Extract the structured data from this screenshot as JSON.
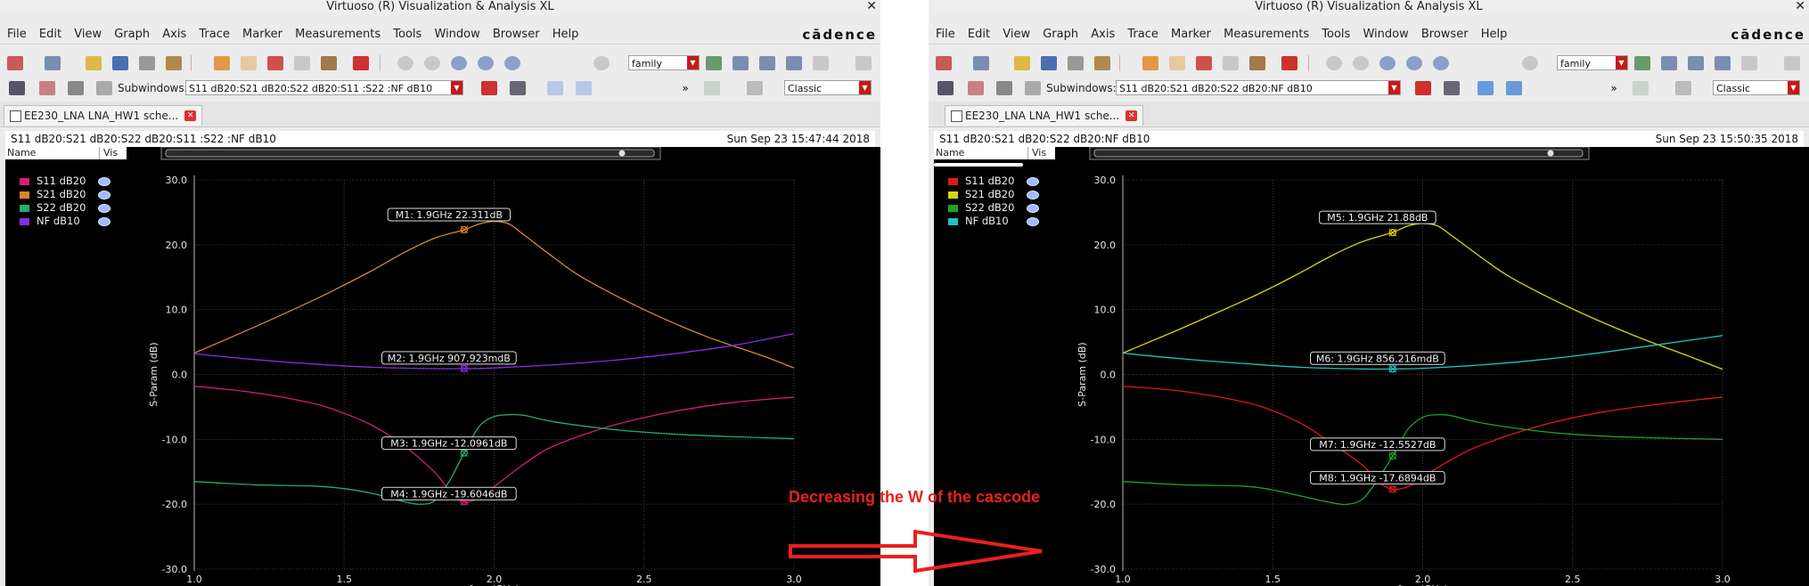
{
  "caption": "Decreasing the W of the cascode",
  "colors": {
    "s11_left": "#d81b79",
    "s21_left": "#d9852a",
    "s22_left": "#20b06a",
    "nf_left": "#8a2be2",
    "s11_right": "#e01818",
    "s21_right": "#d8d40c",
    "s22_right": "#1fa31f",
    "nf_right": "#1ec2c2",
    "arrow": "#e8201e"
  },
  "windows": [
    {
      "title": "Virtuoso (R) Visualization & Analysis XL",
      "logo": "cādence",
      "menu": [
        "File",
        "Edit",
        "View",
        "Graph",
        "Axis",
        "Trace",
        "Marker",
        "Measurements",
        "Tools",
        "Window",
        "Browser",
        "Help"
      ],
      "family_combo": "family",
      "subwindows_label": "Subwindows:",
      "subwindows_value": "S11 dB20:S21 dB20:S22 dB20:S11 :S22 :NF dB10",
      "style_combo": "Classic",
      "tab_label": "EE230_LNA LNA_HW1 sche...",
      "subwindow_name": "S11 dB20:S21 dB20:S22 dB20:S11 :S22 :NF dB10",
      "timestamp": "Sun Sep 23 15:47:44 2018",
      "legend_header": {
        "name": "Name",
        "vis": "Vis"
      },
      "legend": [
        "S11 dB20",
        "S21 dB20",
        "S22 dB20",
        "NF dB10"
      ],
      "chart_data": {
        "type": "line",
        "xlabel": "freq (GHz)",
        "ylabel": "S-Param (dB)",
        "xlim": [
          1.0,
          3.0
        ],
        "ylim": [
          -30.0,
          30.0
        ],
        "xticks": [
          "1.0",
          "1.5",
          "2.0",
          "2.5",
          "3.0"
        ],
        "yticks": [
          "30.0",
          "20.0",
          "10.0",
          "0.0",
          "-10.0",
          "-20.0",
          "-30.0"
        ],
        "grid": true,
        "series": [
          {
            "name": "S11 dB20",
            "color": "s11_left",
            "x": [
              1.0,
              1.2,
              1.4,
              1.5,
              1.6,
              1.7,
              1.8,
              1.85,
              1.9,
              1.95,
              2.0,
              2.1,
              2.2,
              2.4,
              2.6,
              2.8,
              3.0
            ],
            "y": [
              -1.8,
              -2.8,
              -4.5,
              -6.0,
              -8.0,
              -11.0,
              -15.0,
              -17.8,
              -19.6,
              -19.0,
              -17.3,
              -13.8,
              -11.0,
              -7.8,
              -5.7,
              -4.3,
              -3.5
            ]
          },
          {
            "name": "S21 dB20",
            "color": "s21_left",
            "x": [
              1.0,
              1.2,
              1.4,
              1.5,
              1.6,
              1.7,
              1.8,
              1.9,
              1.95,
              2.0,
              2.05,
              2.1,
              2.2,
              2.3,
              2.5,
              2.7,
              2.9,
              3.0
            ],
            "y": [
              3.3,
              7.3,
              11.5,
              13.8,
              16.2,
              18.8,
              21.0,
              22.3,
              23.2,
              23.6,
              23.2,
              21.5,
              18.0,
              14.8,
              10.0,
              6.0,
              2.8,
              1.0
            ]
          },
          {
            "name": "S22 dB20",
            "color": "s22_left",
            "x": [
              1.0,
              1.2,
              1.4,
              1.5,
              1.6,
              1.7,
              1.75,
              1.8,
              1.85,
              1.9,
              1.95,
              2.0,
              2.05,
              2.1,
              2.2,
              2.4,
              2.6,
              2.8,
              3.0
            ],
            "y": [
              -16.5,
              -17.0,
              -17.2,
              -17.6,
              -18.4,
              -19.6,
              -20.0,
              -19.5,
              -16.5,
              -12.1,
              -8.0,
              -6.5,
              -6.2,
              -6.3,
              -7.3,
              -8.5,
              -9.2,
              -9.6,
              -9.9
            ]
          },
          {
            "name": "NF dB10",
            "color": "nf_left",
            "x": [
              1.0,
              1.2,
              1.4,
              1.6,
              1.8,
              1.9,
              2.0,
              2.2,
              2.4,
              2.6,
              2.8,
              3.0
            ],
            "y": [
              3.2,
              2.3,
              1.6,
              1.1,
              0.9,
              0.91,
              1.0,
              1.5,
              2.2,
              3.2,
              4.5,
              6.3
            ]
          }
        ],
        "markers": [
          {
            "label": "M1: 1.9GHz 22.311dB",
            "x": 1.9,
            "y": 22.311,
            "color": "s21_left"
          },
          {
            "label": "M2: 1.9GHz 907.923mdB",
            "x": 1.9,
            "y": 0.908,
            "color": "nf_left"
          },
          {
            "label": "M3: 1.9GHz -12.0961dB",
            "x": 1.9,
            "y": -12.0961,
            "color": "s22_left"
          },
          {
            "label": "M4: 1.9GHz -19.6046dB",
            "x": 1.9,
            "y": -19.6046,
            "color": "s11_left"
          }
        ]
      }
    },
    {
      "title": "Virtuoso (R) Visualization & Analysis XL",
      "logo": "cādence",
      "menu": [
        "File",
        "Edit",
        "View",
        "Graph",
        "Axis",
        "Trace",
        "Marker",
        "Measurements",
        "Tools",
        "Window",
        "Browser",
        "Help"
      ],
      "family_combo": "family",
      "subwindows_label": "Subwindows:",
      "subwindows_value": "S11 dB20:S21 dB20:S22 dB20:NF dB10",
      "style_combo": "Classic",
      "tab_label": "EE230_LNA LNA_HW1 sche...",
      "subwindow_name": "S11 dB20:S21 dB20:S22 dB20:NF dB10",
      "timestamp": "Sun Sep 23 15:50:35 2018",
      "legend_header": {
        "name": "Name",
        "vis": "Vis"
      },
      "legend": [
        "S11 dB20",
        "S21 dB20",
        "S22 dB20",
        "NF dB10"
      ],
      "chart_data": {
        "type": "line",
        "xlabel": "freq (GHz)",
        "ylabel": "S-Param (dB)",
        "xlim": [
          1.0,
          3.0
        ],
        "ylim": [
          -30.0,
          30.0
        ],
        "xticks": [
          "1.0",
          "1.5",
          "2.0",
          "2.5",
          "3.0"
        ],
        "yticks": [
          "30.0",
          "20.0",
          "10.0",
          "0.0",
          "-10.0",
          "-20.0",
          "-30.0"
        ],
        "grid": true,
        "series": [
          {
            "name": "S11 dB20",
            "color": "s11_right",
            "x": [
              1.0,
              1.2,
              1.4,
              1.5,
              1.6,
              1.7,
              1.8,
              1.85,
              1.9,
              1.95,
              2.0,
              2.1,
              2.2,
              2.4,
              2.6,
              2.8,
              3.0
            ],
            "y": [
              -1.8,
              -2.6,
              -4.2,
              -5.6,
              -7.7,
              -10.7,
              -14.0,
              -16.5,
              -17.7,
              -17.3,
              -15.8,
              -13.0,
              -10.8,
              -7.8,
              -5.8,
              -4.5,
              -3.5
            ]
          },
          {
            "name": "S21 dB20",
            "color": "s21_right",
            "x": [
              1.0,
              1.2,
              1.4,
              1.5,
              1.6,
              1.7,
              1.8,
              1.9,
              1.95,
              2.0,
              2.05,
              2.1,
              2.2,
              2.3,
              2.5,
              2.7,
              2.9,
              3.0
            ],
            "y": [
              3.3,
              7.2,
              11.3,
              13.5,
              15.9,
              18.4,
              20.5,
              21.9,
              22.9,
              23.3,
              22.9,
              21.3,
              17.9,
              14.8,
              10.1,
              6.1,
              2.6,
              0.8
            ]
          },
          {
            "name": "S22 dB20",
            "color": "s22_right",
            "x": [
              1.0,
              1.2,
              1.4,
              1.5,
              1.6,
              1.7,
              1.75,
              1.8,
              1.85,
              1.9,
              1.95,
              2.0,
              2.05,
              2.1,
              2.2,
              2.4,
              2.6,
              2.8,
              3.0
            ],
            "y": [
              -16.5,
              -17.0,
              -17.2,
              -17.8,
              -18.8,
              -19.8,
              -20.0,
              -19.2,
              -16.2,
              -12.55,
              -8.5,
              -6.6,
              -6.2,
              -6.4,
              -7.5,
              -8.8,
              -9.5,
              -9.8,
              -10.0
            ]
          },
          {
            "name": "NF dB10",
            "color": "nf_right",
            "x": [
              1.0,
              1.2,
              1.4,
              1.6,
              1.8,
              1.9,
              2.0,
              2.2,
              2.4,
              2.6,
              2.8,
              3.0
            ],
            "y": [
              3.3,
              2.4,
              1.7,
              1.1,
              0.85,
              0.856,
              0.95,
              1.5,
              2.3,
              3.4,
              4.7,
              6.0
            ]
          }
        ],
        "markers": [
          {
            "label": "M5: 1.9GHz 21.88dB",
            "x": 1.9,
            "y": 21.88,
            "color": "s21_right"
          },
          {
            "label": "M6: 1.9GHz 856.216mdB",
            "x": 1.9,
            "y": 0.856,
            "color": "nf_right"
          },
          {
            "label": "M7: 1.9GHz -12.5527dB",
            "x": 1.9,
            "y": -12.5527,
            "color": "s22_right"
          },
          {
            "label": "M8: 1.9GHz -17.6894dB",
            "x": 1.9,
            "y": -17.6894,
            "color": "s11_right"
          }
        ]
      }
    }
  ]
}
